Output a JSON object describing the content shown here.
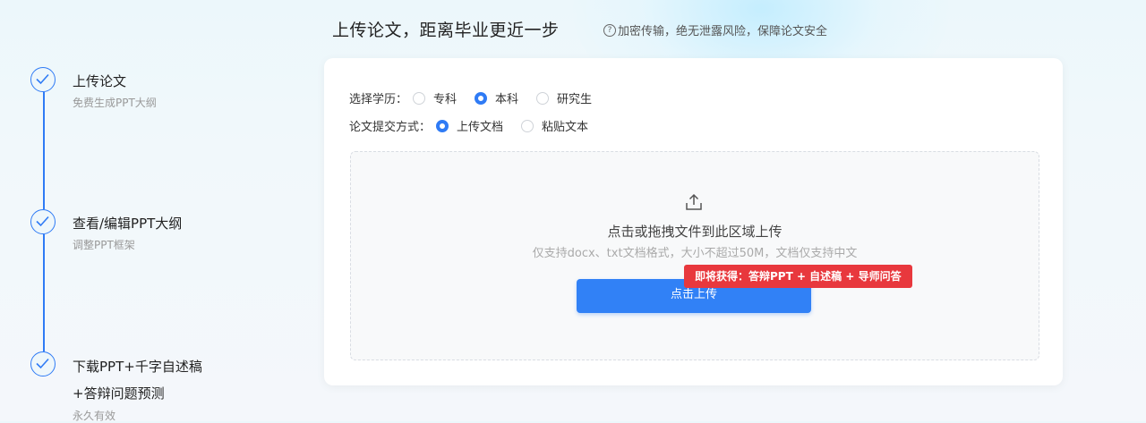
{
  "header": {
    "title": "上传论文，距离毕业更近一步",
    "tip_icon": "?",
    "tip": "加密传输，绝无泄露风险，保障论文安全"
  },
  "steps": [
    {
      "title": "上传论文",
      "subtitle": "免费生成PPT大纲"
    },
    {
      "title": "查看/编辑PPT大纲",
      "subtitle": "调整PPT框架"
    },
    {
      "title_line1": "下载PPT+千字自述稿",
      "title_line2": "+答辩问题预测",
      "subtitle": "永久有效"
    }
  ],
  "form": {
    "education_label": "选择学历：",
    "education_options": [
      "专科",
      "本科",
      "研究生"
    ],
    "education_selected": "本科",
    "submit_method_label": "论文提交方式：",
    "submit_options": [
      "上传文档",
      "粘贴文本"
    ],
    "submit_selected": "上传文档"
  },
  "dropzone": {
    "title": "点击或拖拽文件到此区域上传",
    "hint": "仅支持docx、txt文档格式，大小不超过50M，文档仅支持中文",
    "button_label": "点击上传",
    "badge": "即将获得：答辩PPT + 自述稿 + 导师问答"
  },
  "colors": {
    "accent": "#2f7bf5",
    "badge": "#e8383d"
  }
}
